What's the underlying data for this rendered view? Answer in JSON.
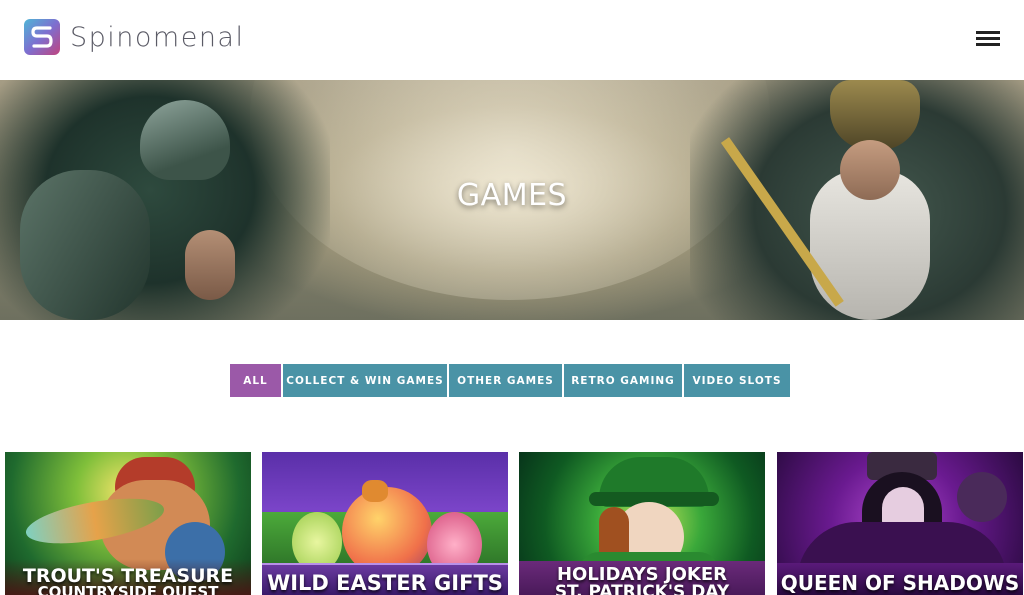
{
  "header": {
    "brand_name": "Spinomenal",
    "logo_icon": "spinomenal-logo-icon",
    "menu_icon": "hamburger-menu-icon"
  },
  "hero": {
    "title": "GAMES"
  },
  "filters": {
    "active_color": "#9b59a8",
    "inactive_color": "#4a93a6",
    "items": [
      {
        "label": "ALL",
        "active": true
      },
      {
        "label": "COLLECT & WIN GAMES",
        "active": false
      },
      {
        "label": "OTHER GAMES",
        "active": false
      },
      {
        "label": "RETRO GAMING",
        "active": false
      },
      {
        "label": "VIDEO SLOTS",
        "active": false
      }
    ]
  },
  "games": [
    {
      "title": "TROUT'S TREASURE",
      "subtitle": "COUNTRYSIDE QUEST"
    },
    {
      "title": "WILD EASTER GIFTS",
      "subtitle": ""
    },
    {
      "title": "HOLIDAYS JOKER",
      "subtitle": "ST. PATRICK'S DAY"
    },
    {
      "title": "QUEEN OF SHADOWS",
      "subtitle": ""
    }
  ]
}
